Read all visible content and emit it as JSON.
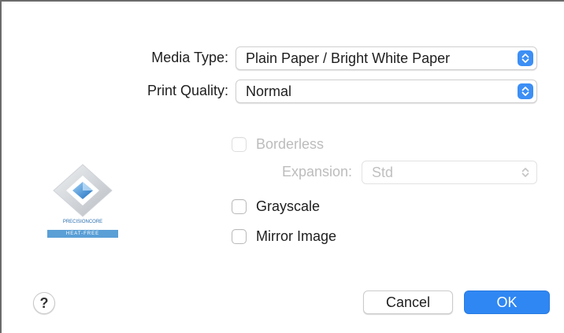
{
  "media_type": {
    "label": "Media Type:",
    "value": "Plain Paper / Bright White Paper"
  },
  "print_quality": {
    "label": "Print Quality:",
    "value": "Normal"
  },
  "borderless": {
    "label": "Borderless",
    "checked": false,
    "enabled": false
  },
  "expansion": {
    "label": "Expansion:",
    "value": "Std",
    "enabled": false
  },
  "grayscale": {
    "label": "Grayscale",
    "checked": false
  },
  "mirror_image": {
    "label": "Mirror Image",
    "checked": false
  },
  "help": {
    "label": "?"
  },
  "buttons": {
    "cancel": "Cancel",
    "ok": "OK"
  },
  "logo": {
    "line1": "PRECISIONCORE",
    "line2": "HEAT-FREE"
  },
  "colors": {
    "accent": "#2f87f3",
    "disabled_text": "#bcbcbc"
  }
}
